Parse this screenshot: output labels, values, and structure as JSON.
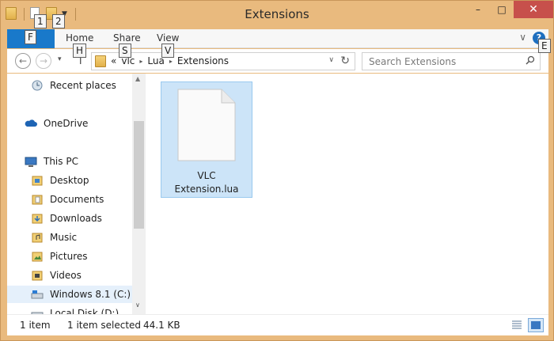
{
  "window": {
    "title": "Extensions",
    "minimize": "–",
    "maximize": "□",
    "close": "✕"
  },
  "keytips": {
    "qat1": "1",
    "qat2": "2",
    "file": "F",
    "home": "H",
    "share": "S",
    "view": "V",
    "help": "E"
  },
  "ribbon": {
    "tabs": [
      "Home",
      "Share",
      "View"
    ],
    "help_glyph": "?",
    "collapse_glyph": "∨"
  },
  "navigation": {
    "back_glyph": "←",
    "forward_glyph": "→",
    "recent_glyph": "▾",
    "up_glyph": "↑"
  },
  "address": {
    "overflow": "«",
    "crumbs": [
      "vlc",
      "Lua",
      "Extensions"
    ],
    "separator": "▸",
    "dropdown_glyph": "∨",
    "refresh_glyph": "↻"
  },
  "search": {
    "placeholder": "Search Extensions",
    "value": ""
  },
  "nav_pane": {
    "items": [
      {
        "label": "Recent places",
        "icon": "recent-places-icon"
      },
      {
        "label": "OneDrive",
        "icon": "onedrive-icon"
      },
      {
        "label": "This PC",
        "icon": "this-pc-icon"
      },
      {
        "label": "Desktop",
        "icon": "desktop-folder-icon"
      },
      {
        "label": "Documents",
        "icon": "documents-folder-icon"
      },
      {
        "label": "Downloads",
        "icon": "downloads-folder-icon"
      },
      {
        "label": "Music",
        "icon": "music-folder-icon"
      },
      {
        "label": "Pictures",
        "icon": "pictures-folder-icon"
      },
      {
        "label": "Videos",
        "icon": "videos-folder-icon"
      },
      {
        "label": "Windows 8.1 (C:)",
        "icon": "drive-icon"
      },
      {
        "label": "Local Disk (D:)",
        "icon": "drive-icon"
      }
    ],
    "scroll_up": "▲",
    "scroll_down": "∨"
  },
  "files": [
    {
      "name_line1": "VLC",
      "name_line2": "Extension.lua",
      "icon": "lua-file-icon",
      "selected": true
    }
  ],
  "status": {
    "count": "1 item",
    "selected": "1 item selected",
    "size": "44.1 KB"
  },
  "colors": {
    "titlebar": "#e9ba7e",
    "file_tab": "#1979ca",
    "close_button": "#c7504b",
    "selection": "#cce4f8"
  }
}
